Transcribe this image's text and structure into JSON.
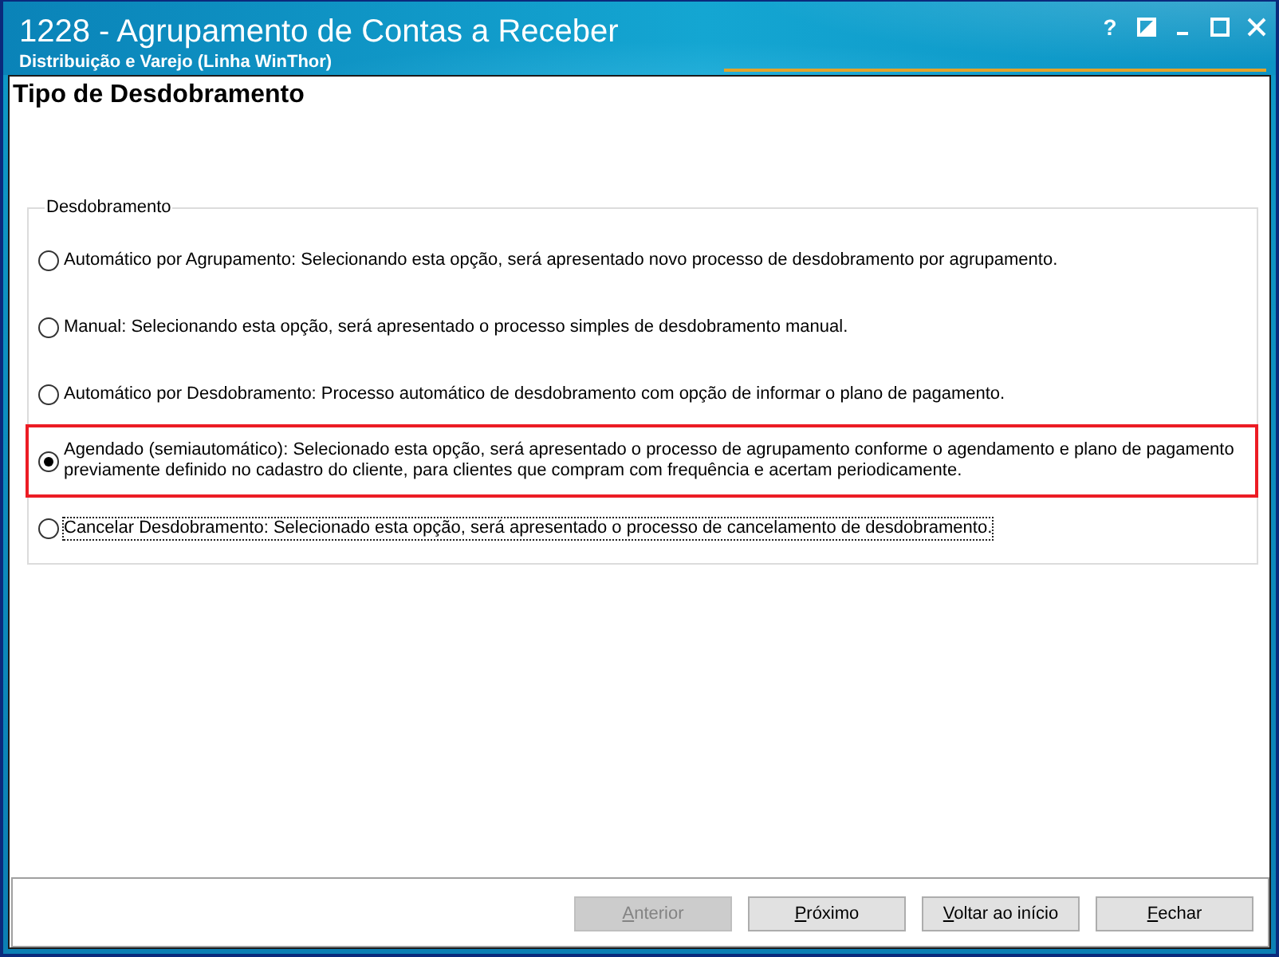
{
  "window": {
    "title": "1228 - Agrupamento de Contas a Receber",
    "subtitle": "Distribuição e Varejo (Linha WinThor)",
    "help": "?"
  },
  "page": {
    "title": "Tipo de Desdobramento"
  },
  "group": {
    "label": "Desdobramento",
    "options": [
      {
        "label": "Automático por Agrupamento: Selecionando esta opção, será apresentado novo processo de desdobramento por agrupamento.",
        "selected": false,
        "highlighted": false,
        "focused": false
      },
      {
        "label": "Manual: Selecionando esta opção, será apresentado o processo simples de desdobramento manual.",
        "selected": false,
        "highlighted": false,
        "focused": false
      },
      {
        "label": "Automático por Desdobramento: Processo automático de desdobramento com opção de informar o plano de pagamento.",
        "selected": false,
        "highlighted": false,
        "focused": false
      },
      {
        "label": "Agendado (semiautomático): Selecionado esta opção, será apresentado o processo de agrupamento conforme o agendamento e plano de pagamento previamente definido no cadastro do cliente, para clientes que compram com frequência e acertam periodicamente.",
        "selected": true,
        "highlighted": true,
        "focused": false
      },
      {
        "label": "Cancelar Desdobramento: Selecionado esta opção, será apresentado o processo de cancelamento de desdobramento.",
        "selected": false,
        "highlighted": false,
        "focused": true
      }
    ]
  },
  "buttons": [
    {
      "label": "Anterior",
      "disabled": true
    },
    {
      "label": "Próximo",
      "disabled": false
    },
    {
      "label": "Voltar ao início",
      "disabled": false
    },
    {
      "label": "Fechar",
      "disabled": false
    }
  ]
}
